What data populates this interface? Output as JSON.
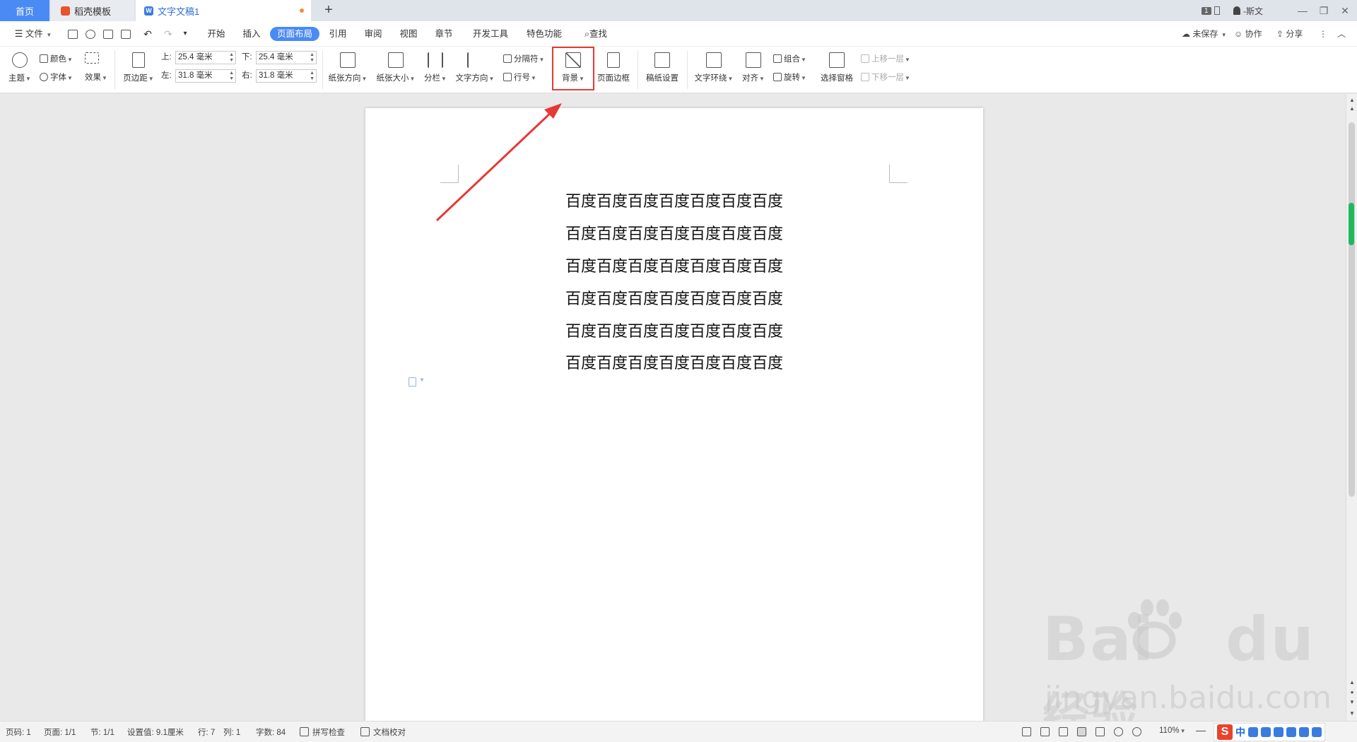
{
  "tabs": {
    "home": "首页",
    "templates": "稻壳模板",
    "document": "文字文稿1",
    "add": "+"
  },
  "titlebar_right": {
    "badge": "1",
    "user": "-斯文",
    "minimize": "—",
    "restore": "❐",
    "close": "✕"
  },
  "menubar": {
    "file": "文件",
    "items": [
      "开始",
      "插入",
      "页面布局",
      "引用",
      "审阅",
      "视图",
      "章节",
      "开发工具",
      "特色功能"
    ],
    "active": "页面布局",
    "search": "查找",
    "unsaved": "未保存",
    "collab": "协作",
    "share": "分享"
  },
  "ribbon": {
    "theme": "主题",
    "color": "颜色",
    "font": "字体",
    "effect": "效果",
    "page_margin": "页边距",
    "margin_top_label": "上:",
    "margin_top_value": "25.4 毫米",
    "margin_bottom_label": "下:",
    "margin_bottom_value": "25.4 毫米",
    "margin_left_label": "左:",
    "margin_left_value": "31.8 毫米",
    "margin_right_label": "右:",
    "margin_right_value": "31.8 毫米",
    "orientation": "纸张方向",
    "paper_size": "纸张大小",
    "columns": "分栏",
    "text_direction": "文字方向",
    "separator": "分隔符",
    "line_number": "行号",
    "background": "背景",
    "page_border": "页面边框",
    "draft_settings": "稿纸设置",
    "text_wrap": "文字环绕",
    "align": "对齐",
    "group": "组合",
    "rotate": "旋转",
    "selection_pane": "选择窗格",
    "bring_forward": "上移一层",
    "send_backward": "下移一层"
  },
  "document": {
    "lines": [
      "百度百度百度百度百度百度百度",
      "百度百度百度百度百度百度百度",
      "百度百度百度百度百度百度百度",
      "百度百度百度百度百度百度百度",
      "百度百度百度百度百度百度百度",
      "百度百度百度百度百度百度百度"
    ]
  },
  "watermark": {
    "logo": "Bai",
    "logo_tail": "du",
    "cn": "经验",
    "url": "jingyan.baidu.com"
  },
  "statusbar": {
    "page_num": "页码: 1",
    "pages": "页面: 1/1",
    "section": "节: 1/1",
    "setting": "设置值: 9.1厘米",
    "row": "行: 7",
    "col": "列: 1",
    "word_count": "字数: 84",
    "spell_check": "拼写检查",
    "doc_proof": "文档校对",
    "zoom": "110%",
    "ime_lang": "中"
  },
  "colors": {
    "accent": "#4a8af4",
    "highlight": "#e53935",
    "arrow": "#e53935"
  }
}
